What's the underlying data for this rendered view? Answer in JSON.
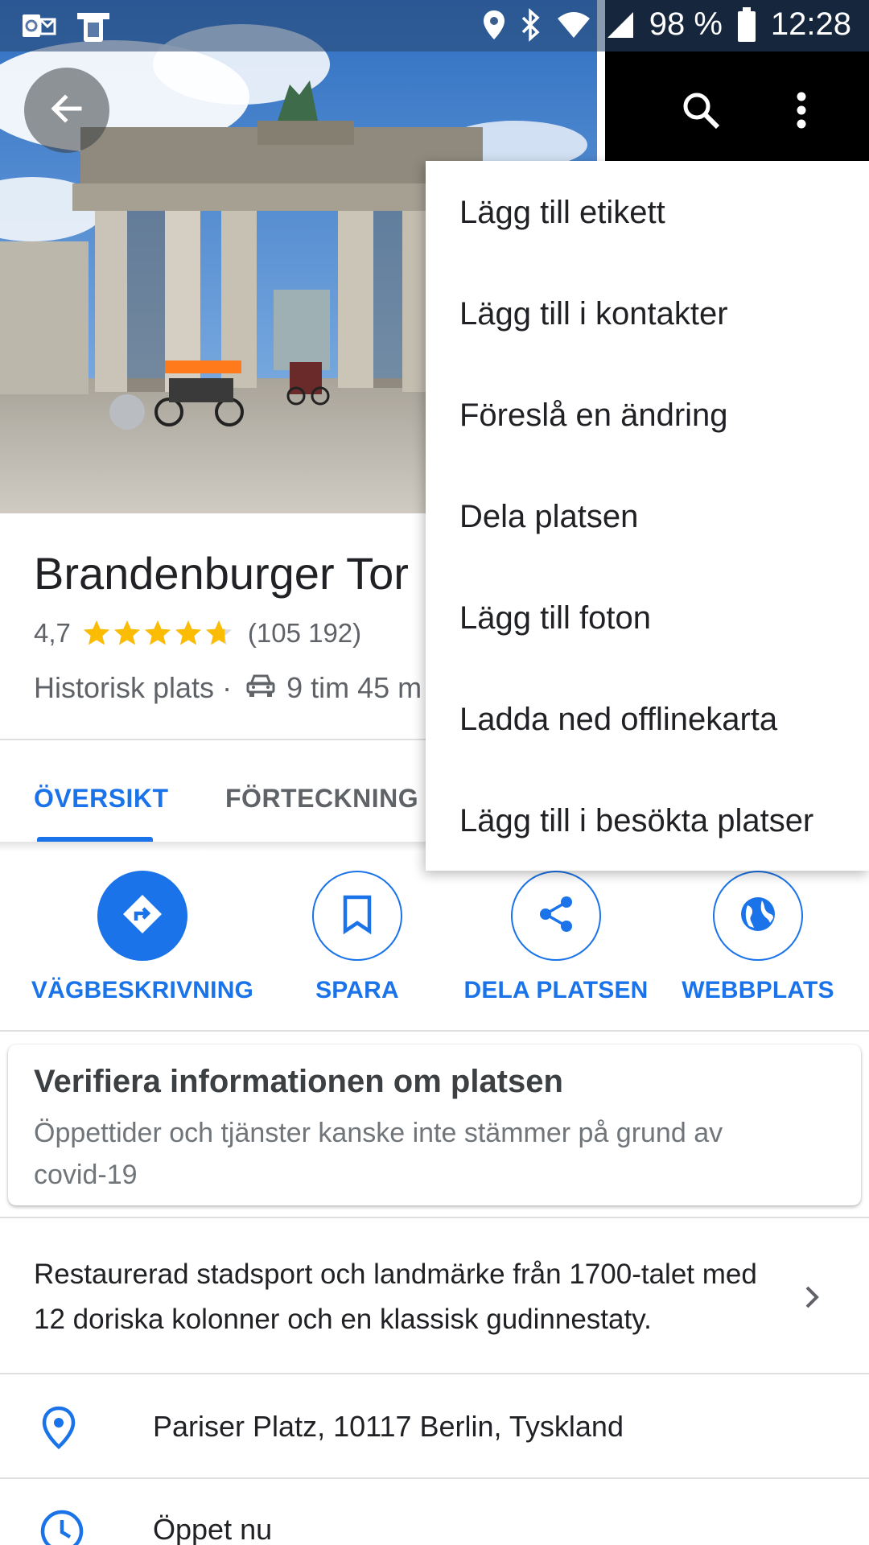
{
  "status_bar": {
    "battery": "98 %",
    "time": "12:28"
  },
  "place": {
    "title": "Brandenburger Tor",
    "rating": "4,7",
    "stars": 4.7,
    "review_count": "(105 192)",
    "category": "Historisk plats",
    "separator": "·",
    "drive_time": "9 tim 45 m"
  },
  "tabs": {
    "overview": "ÖVERSIKT",
    "list": "FÖRTECKNING"
  },
  "actions": {
    "directions": "VÄGBESKRIVNING",
    "save": "SPARA",
    "share": "DELA PLATSEN",
    "website": "WEBBPLATS"
  },
  "verify": {
    "title": "Verifiera informationen om platsen",
    "text": "Öppettider och tjänster kanske inte stämmer på grund av covid-19"
  },
  "description": "Restaurerad stadsport och landmärke från 1700-talet med 12 doriska kolonner och en klassisk gudinnestaty.",
  "address": "Pariser Platz, 10117 Berlin, Tyskland",
  "hours": "Öppet nu",
  "menu": {
    "items": [
      "Lägg till etikett",
      "Lägg till i kontakter",
      "Föreslå en ändring",
      "Dela platsen",
      "Lägg till foton",
      "Ladda ned offlinekarta",
      "Lägg till i besökta platser"
    ]
  },
  "colors": {
    "accent": "#1a73e8",
    "star": "#fbbc04",
    "text_primary": "#202124",
    "text_secondary": "#5f6368"
  }
}
